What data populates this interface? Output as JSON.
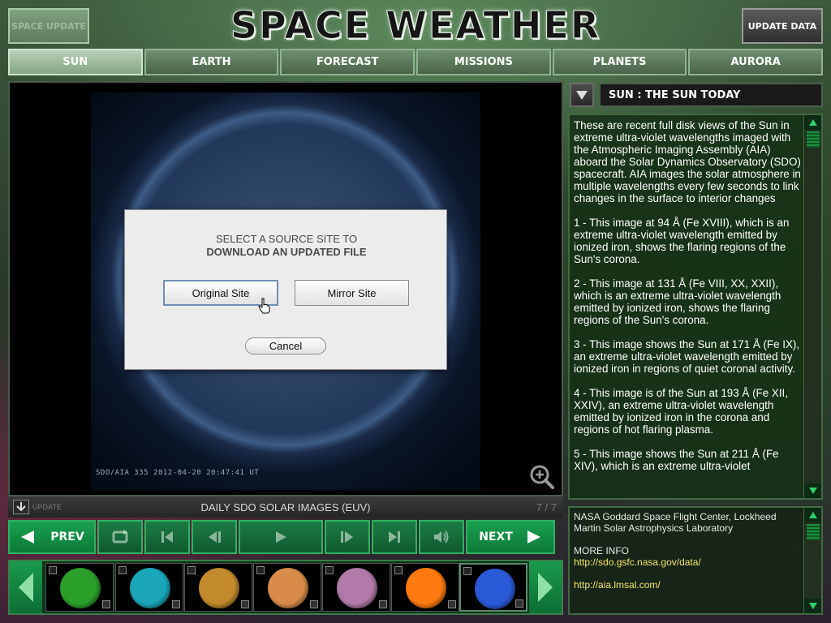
{
  "header": {
    "space_update": "SPACE UPDATE",
    "title": "SPACE WEATHER",
    "update_data": "UPDATE DATA"
  },
  "tabs": [
    {
      "label": "SUN",
      "active": true
    },
    {
      "label": "EARTH",
      "active": false
    },
    {
      "label": "FORECAST",
      "active": false
    },
    {
      "label": "MISSIONS",
      "active": false
    },
    {
      "label": "PLANETS",
      "active": false
    },
    {
      "label": "AURORA",
      "active": false
    }
  ],
  "viewer": {
    "image_stamp": "SDO/AIA  335    2012-04-20 20:47:41 UT",
    "caption_update": "UPDATE",
    "caption": "DAILY SDO SOLAR IMAGES (EUV)",
    "counter": "7 / 7"
  },
  "dialog": {
    "line1": "SELECT A SOURCE SITE TO",
    "line2": "DOWNLOAD AN UPDATED FILE",
    "original": "Original Site",
    "mirror": "Mirror Site",
    "cancel": "Cancel"
  },
  "transport": {
    "prev": "PREV",
    "next": "NEXT"
  },
  "thumbnails": [
    {
      "color": "#2aa02a"
    },
    {
      "color": "#1aa6b8"
    },
    {
      "color": "#c28a2a"
    },
    {
      "color": "#d98c4a"
    },
    {
      "color": "#b27aa8"
    },
    {
      "color": "#ff7a10"
    },
    {
      "color": "#2a5ad8",
      "selected": true
    }
  ],
  "panel": {
    "title": "SUN : THE SUN TODAY",
    "paragraphs": [
      "These are recent full disk views of the Sun in extreme ultra-violet wavelengths imaged with the Atmospheric Imaging Assembly (AIA) aboard the Solar Dynamics Observatory (SDO) spacecraft. AIA images the solar atmosphere in multiple wavelengths every few seconds to link changes in the surface to interior changes",
      "1 - This image at 94 Å (Fe XVIII), which is an extreme ultra-violet wavelength emitted by ionized iron, shows the flaring regions of the Sun's corona.",
      "2 - This image at 131 Å (Fe VIII, XX, XXII), which is an extreme ultra-violet wavelength emitted by ionized iron, shows the flaring regions of the Sun's corona.",
      "3 - This image shows the Sun at 171 Å (Fe IX), an extreme ultra-violet wavelength emitted by ionized iron in regions of quiet coronal activity.",
      "4 - This image is of the Sun at 193 Å (Fe XII, XXIV), an extreme ultra-violet wavelength emitted by ionized iron in the corona and regions of hot flaring plasma.",
      "5 - This image shows the Sun at 211 Å (Fe XIV), which is an extreme ultra-violet"
    ],
    "credit": "NASA Goddard Space Flight Center, Lockheed Martin Solar Astrophysics Laboratory",
    "more_info": "MORE INFO",
    "link1": "http://sdo.gsfc.nasa.gov/data/",
    "link2": "http://aia.lmsal.com/"
  }
}
